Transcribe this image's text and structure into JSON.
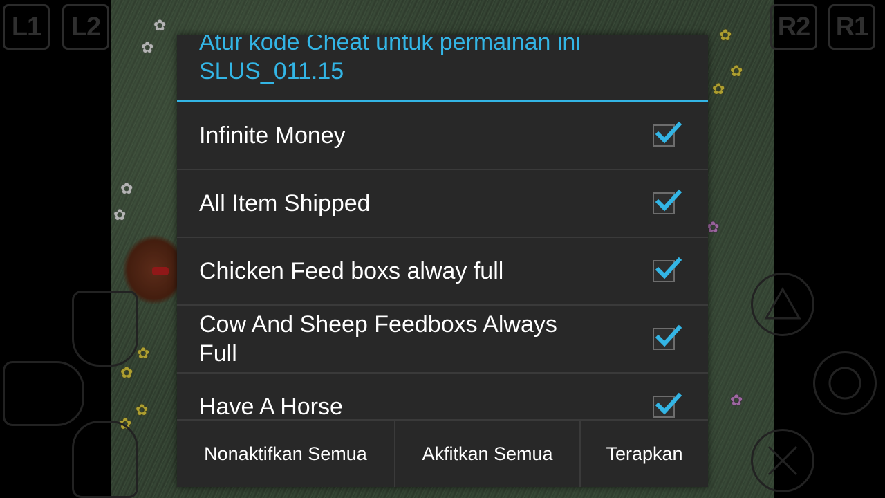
{
  "controller": {
    "l1_label": "L1",
    "l2_label": "L2",
    "r2_label": "R2",
    "r1_label": "R1"
  },
  "dialog": {
    "title_line1": "Atur kode Cheat untuk permainan ini",
    "title_line2": "SLUS_011.15",
    "accent_color": "#33b5e5",
    "cheats": [
      {
        "label": "Infinite Money",
        "checked": true
      },
      {
        "label": "All Item Shipped",
        "checked": true
      },
      {
        "label": "Chicken Feed boxs alway full",
        "checked": true
      },
      {
        "label": "Cow And Sheep Feedboxs Always Full",
        "checked": true
      },
      {
        "label": "Have A Horse",
        "checked": true
      }
    ],
    "buttons": {
      "disable_all": "Nonaktifkan Semua",
      "enable_all": "Akfitkan Semua",
      "apply": "Terapkan"
    }
  }
}
